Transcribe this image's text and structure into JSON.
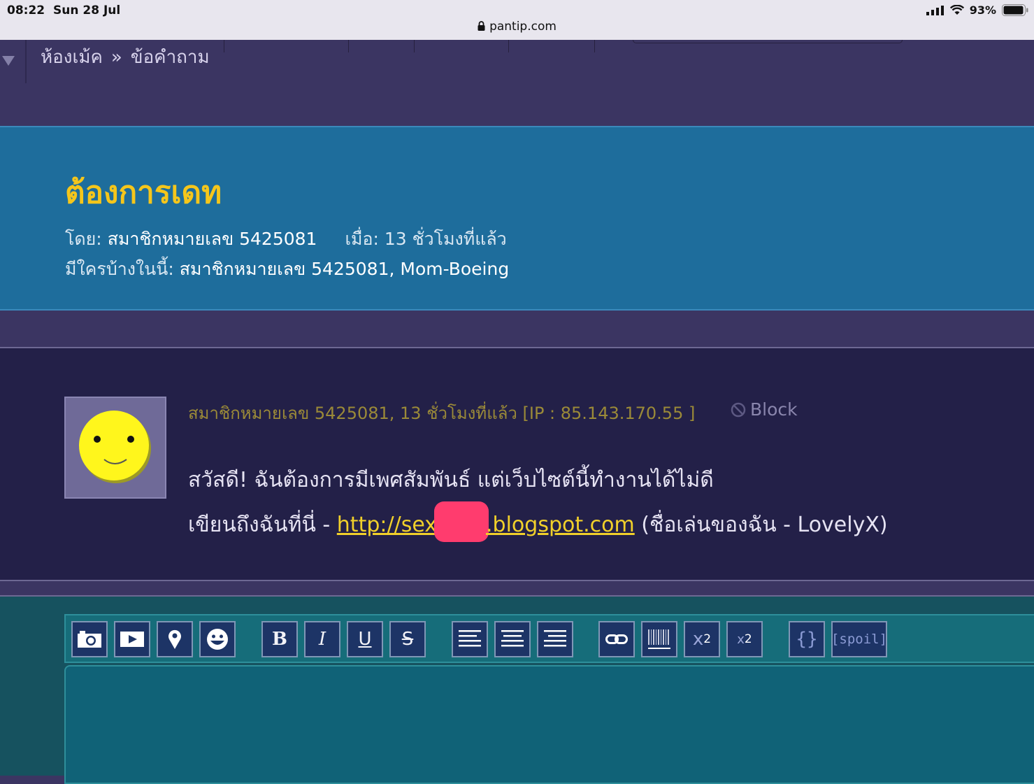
{
  "status_bar": {
    "time": "08:22",
    "date": "Sun 28 Jul",
    "battery": "93%",
    "url": "pantip.com"
  },
  "nav": {
    "crumb_home": "ห้องเม้ค",
    "crumb_sep": "»",
    "crumb_current": "ข้อคำถาม"
  },
  "topic": {
    "title": "ต้องการเดท",
    "by_label": "โดย:",
    "author": "สมาชิกหมายเลข 5425081",
    "when_label": "เมื่อ:",
    "when": "13 ชั่วโมงที่แล้ว",
    "who_here_label": "มีใครบ้างในนี้:",
    "who_here": "สมาชิกหมายเลข 5425081, Mom-Boeing"
  },
  "post": {
    "meta": "สมาชิกหมายเลข 5425081, 13 ชั่วโมงที่แล้ว [IP : 85.143.170.55 ]",
    "block_label": "Block",
    "line1": "สวัสดี! ฉันต้องการมีเพศสัมพันธ์ แต่เว็บไซต์นี้ทำงานได้ไม่ดี",
    "line2_prefix": "เขียนถึงฉันที่นี่ - ",
    "link_start": "http://sex",
    "link_end": ".blogspot.com",
    "line2_suffix": " (ชื่อเล่นของฉัน - LovelyX)"
  },
  "editor": {
    "bold": "B",
    "italic": "I",
    "underline": "U",
    "strike": "S",
    "code": "{}",
    "spoil": "[spoil]",
    "sup_base": "x",
    "sup_exp": "2",
    "sub_base": "x",
    "sub_exp": "2"
  },
  "colors": {
    "title": "#f5c61b",
    "link": "#f1d02a",
    "topic_bg": "#1e6d9c",
    "post_bg": "#232048",
    "editor_bg": "#16525f"
  }
}
